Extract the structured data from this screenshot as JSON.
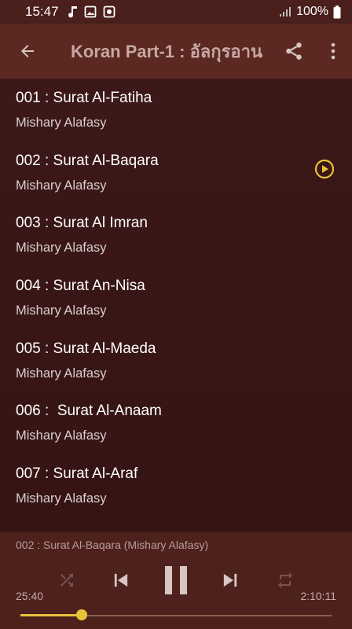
{
  "status_bar": {
    "time": "15:47",
    "battery": "100%"
  },
  "app_bar": {
    "title": "Koran Part-1 : อัลกุรอาน"
  },
  "tracks": [
    {
      "title": "001 : Surat Al-Fatiha",
      "artist": "Mishary Alafasy",
      "playing": false
    },
    {
      "title": "002 : Surat Al-Baqara",
      "artist": "Mishary Alafasy",
      "playing": true
    },
    {
      "title": "003 : Surat Al Imran",
      "artist": "Mishary Alafasy",
      "playing": false
    },
    {
      "title": "004 : Surat An-Nisa",
      "artist": "Mishary Alafasy",
      "playing": false
    },
    {
      "title": "005 : Surat Al-Maeda",
      "artist": "Mishary Alafasy",
      "playing": false
    },
    {
      "title": "006 :  Surat Al-Anaam",
      "artist": "Mishary Alafasy",
      "playing": false
    },
    {
      "title": "007 : Surat Al-Araf",
      "artist": "Mishary Alafasy",
      "playing": false
    }
  ],
  "player": {
    "now_playing": "002 : Surat Al-Baqara (Mishary Alafasy)",
    "elapsed": "25:40",
    "total": "2:10:11",
    "progress": 0.197
  },
  "colors": {
    "accent": "#e8c238",
    "app_bar": "#5b2822",
    "background": "#3a1616"
  }
}
